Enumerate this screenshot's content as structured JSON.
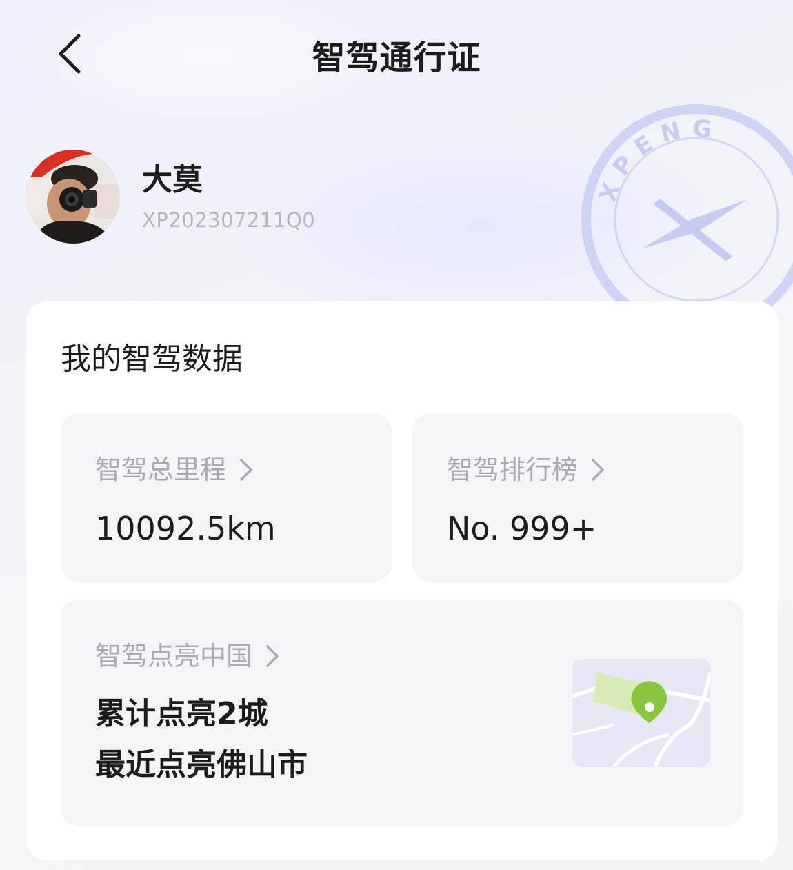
{
  "header": {
    "title": "智驾通行证",
    "back_icon": "chevron-left-icon"
  },
  "profile": {
    "name": "大莫",
    "user_id": "XP202307211Q0"
  },
  "stamp": {
    "brand_text": "XPENG"
  },
  "card": {
    "title": "我的智驾数据",
    "mileage": {
      "label": "智驾总里程",
      "value": "10092.5km"
    },
    "ranking": {
      "label": "智驾排行榜",
      "value": "No. 999+"
    },
    "city_light": {
      "label": "智驾点亮中国",
      "line1": "累计点亮2城",
      "line2": "最近点亮佛山市",
      "map_icon": "map-pin-icon"
    }
  },
  "colors": {
    "accent_green": "#8bc53f",
    "map_green": "#d6ecb4",
    "label_gray": "#a9aab4",
    "stamp_blue": "#c9cdf2"
  }
}
